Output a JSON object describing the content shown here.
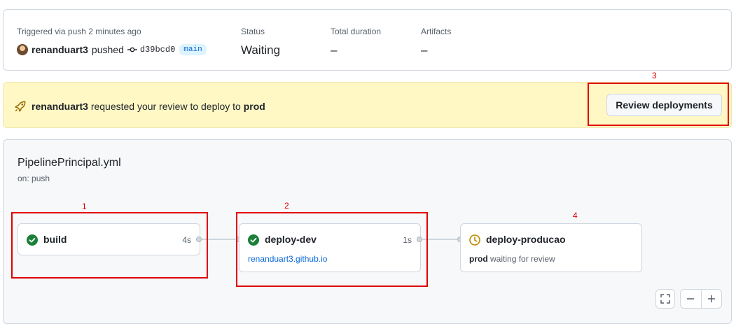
{
  "summary": {
    "trigger_label": "Triggered via push 2 minutes ago",
    "actor": "renanduart3",
    "action": "pushed",
    "commit_sha": "d39bcd0",
    "branch": "main",
    "status_label": "Status",
    "status_value": "Waiting",
    "duration_label": "Total duration",
    "duration_value": "–",
    "artifacts_label": "Artifacts",
    "artifacts_value": "–"
  },
  "review_banner": {
    "actor": "renanduart3",
    "message": "requested your review to deploy to",
    "environment": "prod",
    "button_label": "Review deployments"
  },
  "workflow": {
    "name": "PipelinePrincipal.yml",
    "trigger": "on: push",
    "jobs": [
      {
        "name": "build",
        "duration": "4s",
        "status": "success"
      },
      {
        "name": "deploy-dev",
        "duration": "1s",
        "status": "success",
        "link": "renanduart3.github.io"
      },
      {
        "name": "deploy-producao",
        "status": "waiting",
        "env": "prod",
        "note": "waiting for review"
      }
    ]
  },
  "annotations": [
    "1",
    "2",
    "3",
    "4"
  ],
  "colors": {
    "success": "#1a7f37",
    "waiting": "#bf8700",
    "link": "#0969da",
    "banner_bg": "#fff8c5",
    "annotation": "#e00000"
  },
  "icons": [
    "commit-icon",
    "rocket-icon",
    "check-circle-icon",
    "clock-icon",
    "fullscreen-icon",
    "zoom-out-icon",
    "zoom-in-icon"
  ]
}
